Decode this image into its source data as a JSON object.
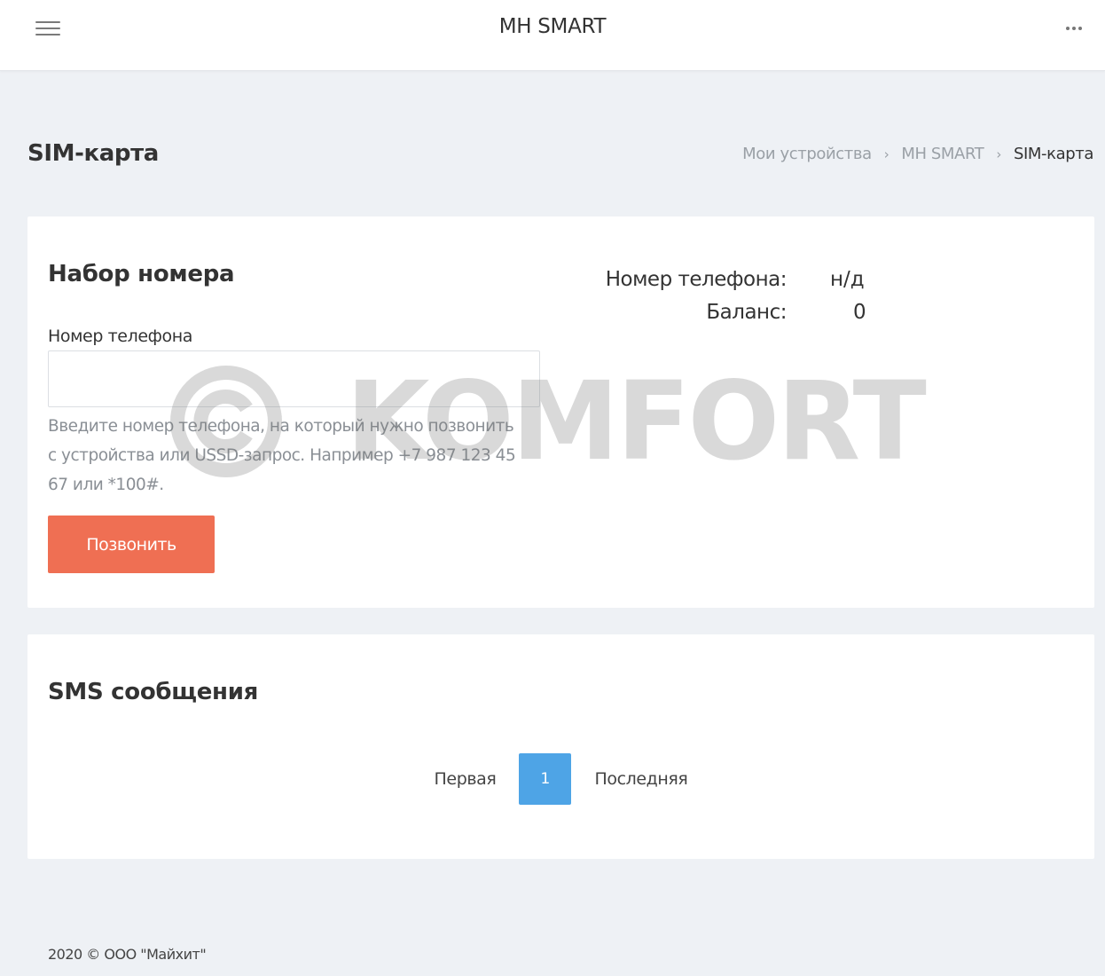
{
  "header": {
    "app_title": "MH SMART",
    "menu_icon": "hamburger-icon",
    "more_icon": "more-horizontal-icon"
  },
  "page": {
    "title": "SIM-карта",
    "breadcrumb": [
      "Мои устройства",
      "MH SMART",
      "SIM-карта"
    ],
    "breadcrumb_separator": "›"
  },
  "dial_panel": {
    "title": "Набор номера",
    "phone_label": "Номер телефона",
    "phone_value": "",
    "phone_placeholder": "",
    "help_text": "Введите номер телефона, на который нужно позвонить с устройства или USSD-запрос. Например +7 987 123 45 67 или *100#.",
    "call_button": "Позвонить",
    "info": {
      "phone_number_label": "Номер телефона:",
      "phone_number_value": "н/д",
      "balance_label": "Баланс:",
      "balance_value": "0"
    }
  },
  "sms_panel": {
    "title": "SMS сообщения",
    "pagination": {
      "first_label": "Первая",
      "current_page": "1",
      "last_label": "Последняя"
    }
  },
  "watermark": {
    "text": "KOMFORT",
    "symbol": "©"
  },
  "footer": {
    "text": "2020 © ООО \"Майхит\""
  },
  "colors": {
    "background": "#eef1f5",
    "call_button": "#ef6f53",
    "pagination_active": "#4ea4e6",
    "muted_text": "#8a8f95"
  }
}
